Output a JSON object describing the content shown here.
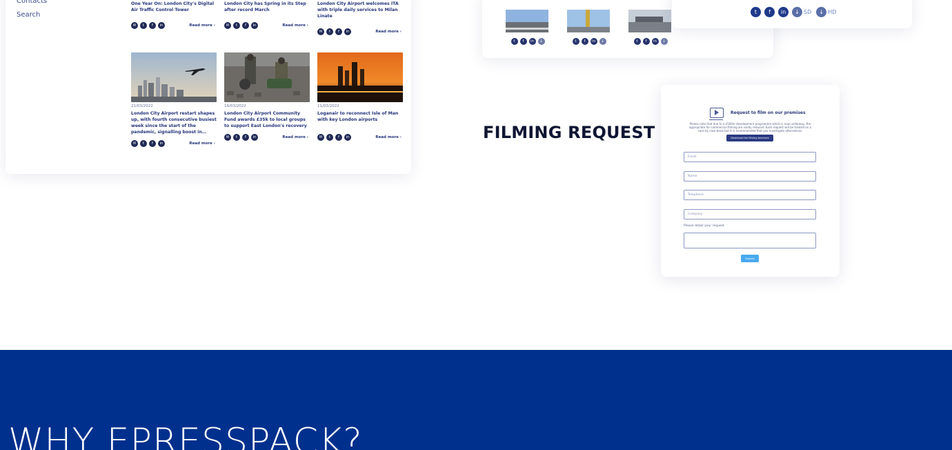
{
  "news": {
    "sidebar": [
      "Contacts",
      "Search"
    ],
    "top_row": [
      {
        "title": "One Year On: London City's Digital Air Traffic Control Tower",
        "read_more": "Read more ›"
      },
      {
        "title": "London City has Spring in its Step after record March",
        "read_more": "Read more ›"
      },
      {
        "title": "London City Airport welcomes ITA with triple daily services to Milan Linate",
        "read_more": "Read more ›"
      }
    ],
    "bottom_row": [
      {
        "date": "21/03/2022",
        "title": "London City Airport restart shapes up, with fourth consecutive busiest week since the start of the pandemic, signalling boost in…",
        "read_more": "Read more ›"
      },
      {
        "date": "16/03/2022",
        "title": "London City Airport Community Fund awards £35k to local groups to support East London's recovery",
        "read_more": "Read more ›"
      },
      {
        "date": "11/03/2022",
        "title": "Loganair to reconnect Isle of Man with key London airports",
        "read_more": "Read more ›"
      }
    ],
    "social_icons": [
      "mail-icon",
      "twitter-icon",
      "facebook-icon",
      "linkedin-icon"
    ]
  },
  "media": {
    "social_icons": [
      "twitter-icon",
      "facebook-icon",
      "linkedin-icon",
      "download-icon"
    ]
  },
  "share": {
    "social_icons": [
      "twitter-icon",
      "facebook-icon",
      "linkedin-icon"
    ],
    "sd_label": "SD",
    "hd_label": "HD"
  },
  "filming": {
    "heading": "FILMING REQUEST",
    "form_title": "Request to film on our premises",
    "form_description": "Please note that due to a £500m development programme which is now underway, the appropriate for commercial filming are vastly reduced. Each request will be treated on a case by case basis but it is recommended that you investigate alternatives.",
    "download_label": "Download the filming brochure",
    "fields": {
      "email": "Email",
      "name": "Name",
      "telephone": "Telephone",
      "company": "Company"
    },
    "request_label": "Please detail your request",
    "submit_label": "Submit"
  },
  "band": {
    "title": "WHY EPRESSPACK?"
  },
  "colors": {
    "band_blue": "#00308d",
    "navy_text": "#1b2a6b",
    "submit_blue": "#48a9ef"
  }
}
